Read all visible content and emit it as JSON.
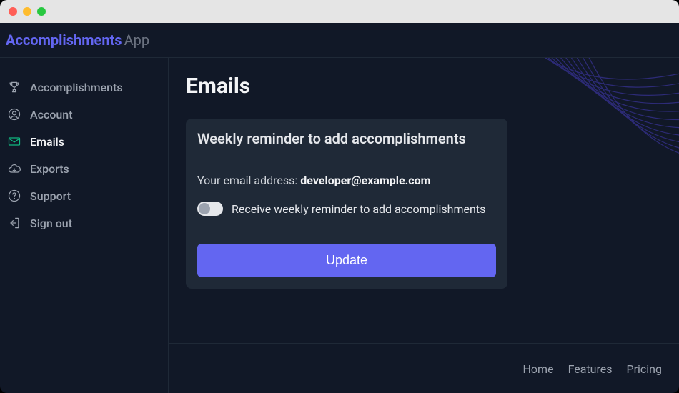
{
  "brand": {
    "primary": "Accomplishments",
    "secondary": "App"
  },
  "sidebar": {
    "items": [
      {
        "label": "Accomplishments"
      },
      {
        "label": "Account"
      },
      {
        "label": "Emails"
      },
      {
        "label": "Exports"
      },
      {
        "label": "Support"
      },
      {
        "label": "Sign out"
      }
    ]
  },
  "page": {
    "title": "Emails"
  },
  "card": {
    "title": "Weekly reminder to add accomplishments",
    "email_label": "Your email address: ",
    "email_value": "developer@example.com",
    "toggle_label": "Receive weekly reminder to add accomplishments",
    "toggle_on": false,
    "button_label": "Update"
  },
  "footer": {
    "links": [
      {
        "label": "Home"
      },
      {
        "label": "Features"
      },
      {
        "label": "Pricing"
      }
    ]
  },
  "colors": {
    "accent": "#6366f1",
    "bg": "#111827",
    "panel": "#1f2937",
    "active_icon": "#10b981"
  }
}
